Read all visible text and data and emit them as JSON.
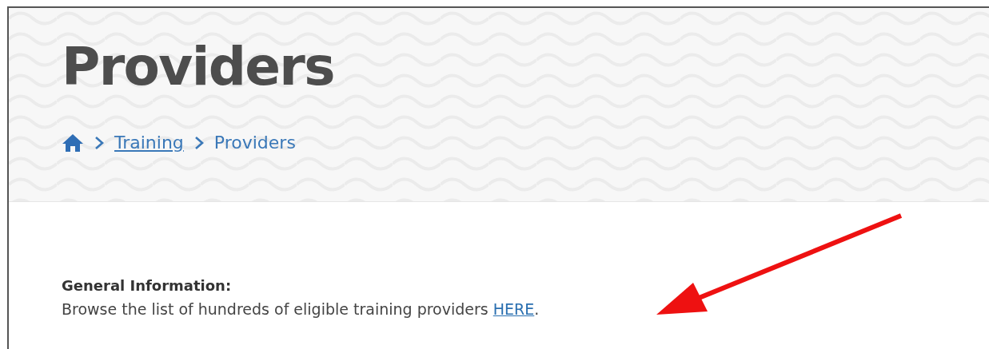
{
  "page_title": "Providers",
  "breadcrumb": [
    {
      "kind": "home"
    },
    {
      "kind": "link",
      "label": "Training"
    },
    {
      "kind": "current",
      "label": "Providers"
    }
  ],
  "section": {
    "heading": "General Information:",
    "text_before": "Browse the list of hundreds of eligible training providers ",
    "link": "HERE",
    "text_after": "."
  }
}
